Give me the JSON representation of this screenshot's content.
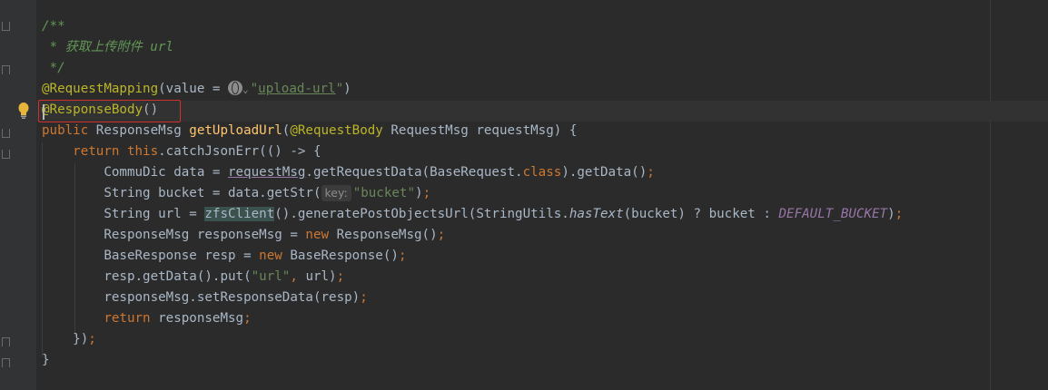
{
  "editor": {
    "lines": [
      {
        "tokens": [
          {
            "t": "/**",
            "c": "cm"
          }
        ]
      },
      {
        "tokens": [
          {
            "t": " * 获取上传附件 url",
            "c": "cm"
          }
        ]
      },
      {
        "tokens": [
          {
            "t": " */",
            "c": "cm"
          }
        ]
      },
      {
        "tokens": [
          {
            "t": "@RequestMapping",
            "c": "an"
          },
          {
            "t": "(value = "
          },
          {
            "t": "",
            "c": "globe"
          },
          {
            "t": "⌄",
            "c": "chev"
          },
          {
            "t": "\"",
            "c": "str"
          },
          {
            "t": "upload-url",
            "c": "str-ul"
          },
          {
            "t": "\"",
            "c": "str"
          },
          {
            "t": ")"
          }
        ]
      },
      {
        "tokens": [
          {
            "t": "@ResponseBody",
            "c": "an"
          },
          {
            "t": "()"
          }
        ]
      },
      {
        "tokens": [
          {
            "t": "public ",
            "c": "kw"
          },
          {
            "t": "ResponseMsg "
          },
          {
            "t": "getUploadUrl",
            "c": "fn"
          },
          {
            "t": "("
          },
          {
            "t": "@RequestBody ",
            "c": "an"
          },
          {
            "t": "RequestMsg requestMsg) {"
          }
        ]
      },
      {
        "tokens": [
          {
            "t": "    "
          },
          {
            "t": "return this",
            "c": "kw"
          },
          {
            "t": ".catchJsonErr(() -> {"
          }
        ]
      },
      {
        "tokens": [
          {
            "t": "        CommuDic data = "
          },
          {
            "t": "requestMsg",
            "c": "purple-ul"
          },
          {
            "t": ".getRequestData(BaseRequest."
          },
          {
            "t": "class",
            "c": "kw"
          },
          {
            "t": ").getData()"
          },
          {
            "t": ";",
            "c": "kw"
          }
        ]
      },
      {
        "tokens": [
          {
            "t": "        String bucket = data.getStr("
          },
          {
            "t": "key:",
            "c": "hint"
          },
          {
            "t": "\"bucket\"",
            "c": "str"
          },
          {
            "t": ")"
          },
          {
            "t": ";",
            "c": "kw"
          }
        ]
      },
      {
        "tokens": [
          {
            "t": "        String url = "
          },
          {
            "t": "zfsClient",
            "c": "hilite"
          },
          {
            "t": "().generatePostObjectsUrl(StringUtils."
          },
          {
            "t": "hasText",
            "c": "static"
          },
          {
            "t": "(bucket) ? bucket : "
          },
          {
            "t": "DEFAULT_BUCKET",
            "c": "const"
          },
          {
            "t": ")"
          },
          {
            "t": ";",
            "c": "kw"
          }
        ]
      },
      {
        "tokens": [
          {
            "t": "        ResponseMsg responseMsg = "
          },
          {
            "t": "new ",
            "c": "kw"
          },
          {
            "t": "ResponseMsg()"
          },
          {
            "t": ";",
            "c": "kw"
          }
        ]
      },
      {
        "tokens": [
          {
            "t": "        BaseResponse resp = "
          },
          {
            "t": "new ",
            "c": "kw"
          },
          {
            "t": "BaseResponse()"
          },
          {
            "t": ";",
            "c": "kw"
          }
        ]
      },
      {
        "tokens": [
          {
            "t": "        resp.getData().put("
          },
          {
            "t": "\"url\"",
            "c": "str"
          },
          {
            "t": ", ",
            "c": "kw"
          },
          {
            "t": "url)"
          },
          {
            "t": ";",
            "c": "kw"
          }
        ]
      },
      {
        "tokens": [
          {
            "t": "        responseMsg.setResponseData(resp)"
          },
          {
            "t": ";",
            "c": "kw"
          }
        ]
      },
      {
        "tokens": [
          {
            "t": "        "
          },
          {
            "t": "return ",
            "c": "kw"
          },
          {
            "t": "responseMsg"
          },
          {
            "t": ";",
            "c": "kw"
          }
        ]
      },
      {
        "tokens": [
          {
            "t": "    })"
          },
          {
            "t": ";",
            "c": "kw"
          }
        ]
      },
      {
        "tokens": [
          {
            "t": "}"
          }
        ]
      }
    ]
  }
}
